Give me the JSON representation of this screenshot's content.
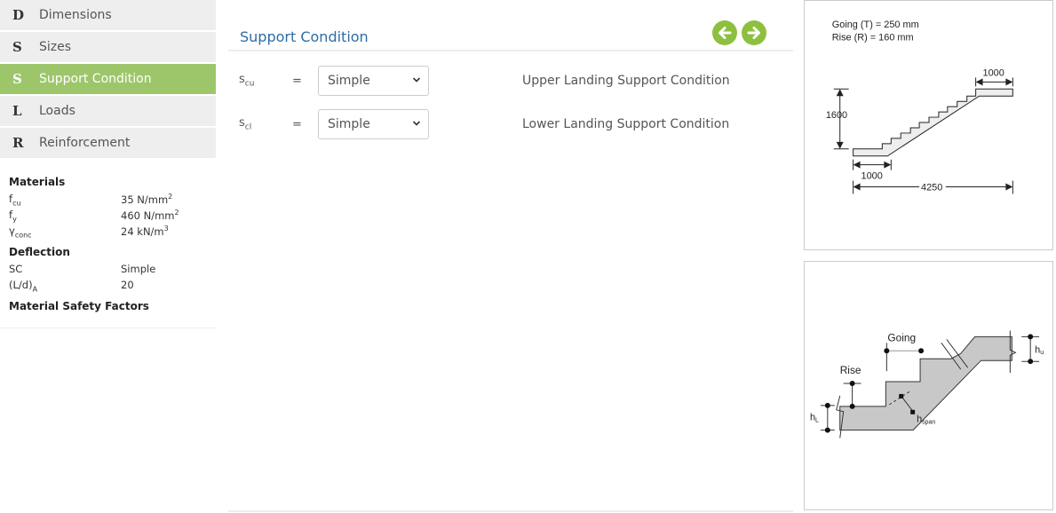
{
  "sidebar": {
    "items": [
      {
        "letter": "D",
        "label": "Dimensions",
        "active": false
      },
      {
        "letter": "S",
        "label": "Sizes",
        "active": false
      },
      {
        "letter": "S",
        "label": "Support Condition",
        "active": true
      },
      {
        "letter": "L",
        "label": "Loads",
        "active": false
      },
      {
        "letter": "R",
        "label": "Reinforcement",
        "active": false
      }
    ],
    "active_color": "#9dc66b",
    "summary": {
      "materials_heading": "Materials",
      "materials": [
        {
          "key": "f",
          "key_sub": "cu",
          "value": "35 N/mm",
          "value_sup": "2"
        },
        {
          "key": "f",
          "key_sub": "y",
          "value": "460 N/mm",
          "value_sup": "2"
        },
        {
          "key": "γ",
          "key_sub": "conc",
          "value": "24 kN/m",
          "value_sup": "3"
        }
      ],
      "deflection_heading": "Deflection",
      "deflection": [
        {
          "key": "SC",
          "key_sub": "",
          "value": "Simple"
        },
        {
          "key": "(L/d)",
          "key_sub": "A",
          "value": "20"
        }
      ],
      "safety_heading": "Material Safety Factors"
    }
  },
  "main": {
    "title": "Support Condition",
    "title_color": "#2e6da4",
    "prev_icon": "arrow-left-circle-icon",
    "next_icon": "arrow-right-circle-icon",
    "arrow_color": "#8dc03f",
    "rows": [
      {
        "symbol": "s",
        "symbol_sub": "cu",
        "equals": "=",
        "value": "Simple",
        "description": "Upper Landing Support Condition"
      },
      {
        "symbol": "s",
        "symbol_sub": "cl",
        "equals": "=",
        "value": "Simple",
        "description": "Lower Landing Support Condition"
      }
    ]
  },
  "diagram_top": {
    "going_label": "Going (T) = 250 mm",
    "rise_label": "Rise   (R) = 160 mm",
    "upper_landing": "1000",
    "height": "1600",
    "lower_landing": "1000",
    "total_length": "4250"
  },
  "diagram_bottom": {
    "going": "Going",
    "rise": "Rise",
    "h_lower": "h",
    "h_lower_sub": "L",
    "h_span": "h",
    "h_span_sub": "span",
    "h_upper": "h",
    "h_upper_sub": "u"
  }
}
